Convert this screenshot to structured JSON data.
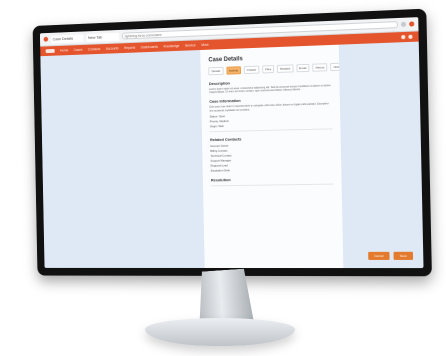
{
  "browser": {
    "tab_labels": [
      "Case Details",
      "New Tab"
    ],
    "address_bar": "lightning.force.com/cases"
  },
  "topnav": {
    "items": [
      "Home",
      "Cases",
      "Contacts",
      "Accounts",
      "Reports",
      "Dashboards",
      "Knowledge",
      "Service",
      "More"
    ]
  },
  "page": {
    "title": "Case Details",
    "tabs": [
      "Details",
      "Activity",
      "Chatter",
      "Files",
      "Related",
      "Email",
      "History",
      "Notes"
    ],
    "section_1": "Description",
    "section_2": "Case Information",
    "section_3": "Related Contacts",
    "section_4": "Resolution",
    "para_1": "Lorem ipsum dolor sit amet, consectetur adipiscing elit. Sed do eiusmod tempor incididunt ut labore et dolore magna aliqua. Ut enim ad minim veniam, quis nostrud exercitation ullamco laboris.",
    "para_2": "Duis aute irure dolor in reprehenderit in voluptate velit esse cillum dolore eu fugiat nulla pariatur. Excepteur sint occaecat cupidatat non proident.",
    "kv": [
      "Status: Open",
      "Priority: Medium",
      "Origin: Web"
    ],
    "list": [
      "Account Owner",
      "Billing Contact",
      "Technical Contact",
      "Support Manager",
      "Regional Lead",
      "Escalation Desk"
    ],
    "actions": [
      "Cancel",
      "Save"
    ]
  }
}
